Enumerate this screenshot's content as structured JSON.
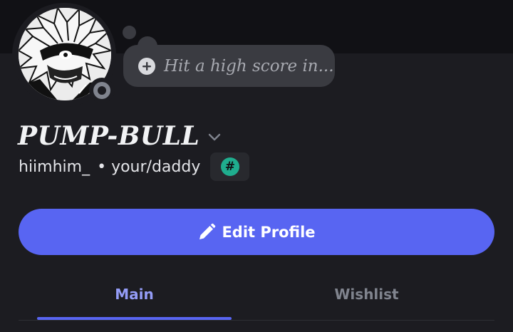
{
  "profile": {
    "display_name": "PUMP-BULL",
    "username": "hiimhim_",
    "separator": "•",
    "pronouns": "your/daddy",
    "status_text": "Hit a high score in...",
    "tag_symbol": "#",
    "online_status": "offline"
  },
  "actions": {
    "edit_profile_label": "Edit Profile"
  },
  "tabs": [
    {
      "label": "Main",
      "active": true
    },
    {
      "label": "Wishlist",
      "active": false
    }
  ],
  "colors": {
    "accent": "#5865f2",
    "active_tab": "#949cf7",
    "tag_badge": "#1fad8e",
    "background": "#1c1c21"
  }
}
